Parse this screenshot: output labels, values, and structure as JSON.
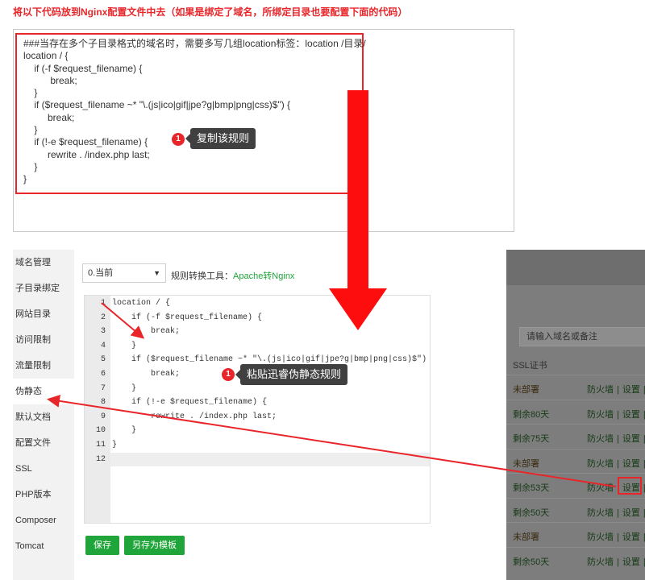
{
  "instruction": "将以下代码放到Nginx配置文件中去（如果是绑定了域名，所绑定目录也要配置下面的代码）",
  "top_code": "###当存在多个子目录格式的域名时，需要多写几组location标签：location /目录/\nlocation / {\n    if (-f $request_filename) {\n          break;\n    }\n    if ($request_filename ~* \"\\.(js|ico|gif|jpe?g|bmp|png|css)$\") {\n         break;\n    }\n    if (!-e $request_filename) {\n         rewrite . /index.php last;\n    }\n}",
  "callout_copy": {
    "badge": "1",
    "text": "复制该规则"
  },
  "callout_paste": {
    "badge": "1",
    "text": "粘贴迅睿伪静态规则"
  },
  "sidebar": {
    "items": [
      {
        "label": "域名管理"
      },
      {
        "label": "子目录绑定"
      },
      {
        "label": "网站目录"
      },
      {
        "label": "访问限制"
      },
      {
        "label": "流量限制"
      },
      {
        "label": "伪静态",
        "active": true
      },
      {
        "label": "默认文档"
      },
      {
        "label": "配置文件"
      },
      {
        "label": "SSL"
      },
      {
        "label": "PHP版本"
      },
      {
        "label": "Composer"
      },
      {
        "label": "Tomcat"
      }
    ]
  },
  "toolbar": {
    "version_select": "0.当前",
    "rule_tool_label": "规则转换工具：",
    "rule_tool_link": "Apache转Nginx"
  },
  "editor": {
    "lines": [
      {
        "n": "1",
        "text": "location / {"
      },
      {
        "n": "2",
        "text": "    if (-f $request_filename) {"
      },
      {
        "n": "3",
        "text": "        break;"
      },
      {
        "n": "4",
        "text": "    }"
      },
      {
        "n": "5",
        "text": "    if ($request_filename ~* \"\\.(js|ico|gif|jpe?g|bmp|png|css)$\") {"
      },
      {
        "n": "6",
        "text": "        break;"
      },
      {
        "n": "7",
        "text": "    }"
      },
      {
        "n": "8",
        "text": "    if (!-e $request_filename) {"
      },
      {
        "n": "9",
        "text": "        rewrite . /index.php last;"
      },
      {
        "n": "10",
        "text": "    }"
      },
      {
        "n": "11",
        "text": "}"
      },
      {
        "n": "12",
        "text": ""
      }
    ],
    "active_line": "12"
  },
  "buttons": {
    "save": "保存",
    "save_as_template": "另存为模板"
  },
  "right_panel": {
    "search_placeholder": "请输入域名或备注",
    "column_ssl": "SSL证书",
    "firewall": "防火墙",
    "separator": "|",
    "settings": "设置",
    "rows": [
      {
        "ssl": "未部署",
        "status": "none"
      },
      {
        "ssl": "剩余80天",
        "status": "left"
      },
      {
        "ssl": "剩余75天",
        "status": "left"
      },
      {
        "ssl": "未部署",
        "status": "none"
      },
      {
        "ssl": "剩余53天",
        "status": "left"
      },
      {
        "ssl": "剩余50天",
        "status": "left"
      },
      {
        "ssl": "未部署",
        "status": "none"
      },
      {
        "ssl": "剩余50天",
        "status": "left"
      }
    ]
  },
  "colors": {
    "annotation_red": "#e8262a",
    "primary_green": "#20a53a",
    "callout_bg": "#404040"
  }
}
